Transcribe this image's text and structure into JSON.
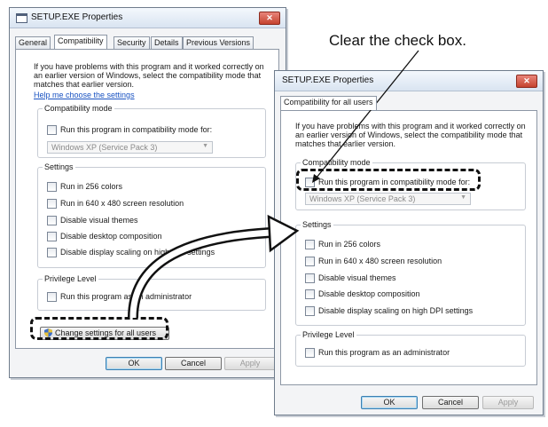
{
  "dialog1": {
    "title": "SETUP.EXE Properties",
    "close": "✕",
    "tabs": [
      "General",
      "Compatibility",
      "Security",
      "Details",
      "Previous Versions"
    ],
    "active_tab": "Compatibility",
    "intro": "If you have problems with this program and it worked correctly on an earlier version of Windows, select the compatibility mode that matches that earlier version.",
    "help_link": "Help me choose the settings",
    "compat_group": "Compatibility mode",
    "compat_checkbox": "Run this program in compatibility mode for:",
    "compat_select": "Windows XP (Service Pack 3)",
    "settings_group": "Settings",
    "settings": [
      "Run in 256 colors",
      "Run in 640 x 480 screen resolution",
      "Disable visual themes",
      "Disable desktop composition",
      "Disable display scaling on high DPI settings"
    ],
    "privilege_group": "Privilege Level",
    "privilege_checkbox": "Run this program as an administrator",
    "change_all_users": "Change settings for all users",
    "ok": "OK",
    "cancel": "Cancel",
    "apply": "Apply"
  },
  "dialog2": {
    "title": "SETUP.EXE Properties",
    "close": "✕",
    "tab": "Compatibility for all users",
    "intro": "If you have problems with this program and it worked correctly on an earlier version of Windows, select the compatibility mode that matches that earlier version.",
    "compat_group": "Compatibility mode",
    "compat_checkbox": "Run this program in compatibility mode for:",
    "compat_select": "Windows XP (Service Pack 3)",
    "settings_group": "Settings",
    "settings": [
      "Run in 256 colors",
      "Run in 640 x 480 screen resolution",
      "Disable visual themes",
      "Disable desktop composition",
      "Disable display scaling on high DPI settings"
    ],
    "privilege_group": "Privilege Level",
    "privilege_checkbox": "Run this program as an administrator",
    "ok": "OK",
    "cancel": "Cancel",
    "apply": "Apply"
  },
  "callout": "Clear the check box.",
  "colors": {
    "link": "#1a53c2",
    "close": "#c5432f",
    "default_button_border": "#3c7fb1"
  }
}
